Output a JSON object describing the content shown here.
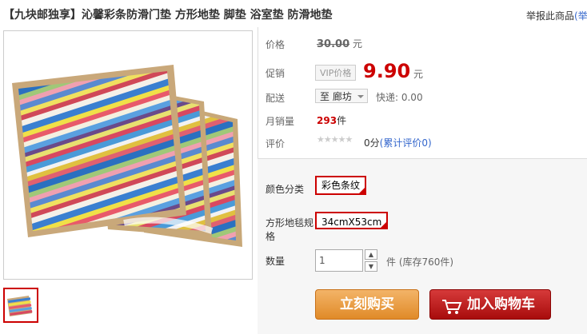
{
  "product": {
    "title": "【九块邮独享】沁馨彩条防滑门垫 方形地垫 脚垫 浴室垫 防滑地垫",
    "report_text": "举报此商品",
    "report_link": "(举"
  },
  "price": {
    "label": "价格",
    "original": "30.00",
    "unit": "元"
  },
  "promo": {
    "label": "促销",
    "badge": "VIP价格",
    "price": "9.90",
    "unit": "元"
  },
  "delivery": {
    "label": "配送",
    "selected": "至 廊坊",
    "shipping": "快递: 0.00"
  },
  "sales": {
    "label": "月销量",
    "count": "293",
    "unit": "件"
  },
  "rating": {
    "label": "评价",
    "stars_glyph": "★★★★★",
    "score": "0分",
    "link": "(累计评价0)"
  },
  "options": {
    "color_label": "颜色分类",
    "color_value": "彩色条纹",
    "size_label_line1": "方形地毯规",
    "size_label_line2": "格",
    "size_value": "34cmX53cm"
  },
  "quantity": {
    "label": "数量",
    "value": "1",
    "up_glyph": "▲",
    "down_glyph": "▼",
    "unit": "件",
    "stock": "(库存760件)"
  },
  "buttons": {
    "buy": "立刻购买",
    "cart": "加入购物车"
  },
  "icons": {
    "cart": "shopping-cart-icon",
    "dropdown": "chevron-down-icon",
    "selected": "checkmark-corner-icon"
  },
  "colors": {
    "price_red": "#cc0000",
    "buy_orange": "#e08a28",
    "cart_red": "#a80c0c",
    "link_blue": "#3366cc"
  }
}
